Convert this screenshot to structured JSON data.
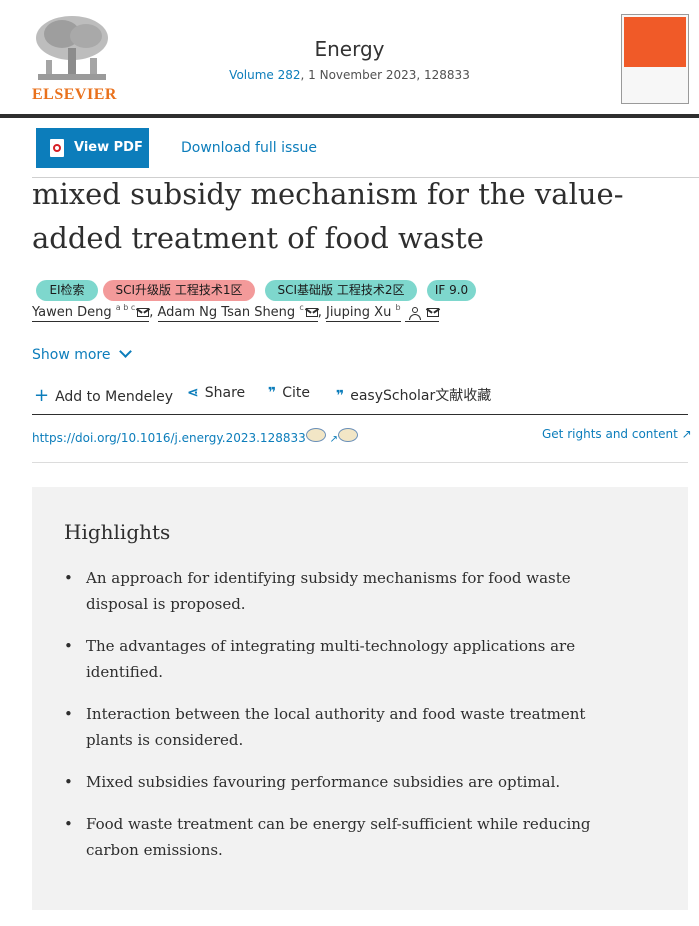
{
  "header": {
    "publisher_logo_text": "ELSEVIER",
    "journal_title": "Energy",
    "volume_link": "Volume 282",
    "issue_info": ", 1 November 2023, 128833"
  },
  "toolbar": {
    "view_pdf_label": "View PDF",
    "download_label": "Download full issue"
  },
  "article": {
    "title": "mixed subsidy mechanism for the value-added treatment of food waste",
    "badges": [
      "EI检索",
      "SCI升级版 工程技术1区",
      "SCI基础版 工程技术2区",
      "IF 9.0"
    ],
    "authors": [
      {
        "name": "Yawen Deng",
        "affil": "a b c"
      },
      {
        "name": "Adam Ng Tsan Sheng",
        "affil": "c"
      },
      {
        "name": "Jiuping Xu",
        "affil": "b"
      }
    ],
    "show_more_label": "Show more"
  },
  "actions": {
    "mendeley": "Add to Mendeley",
    "share": "Share",
    "cite": "Cite",
    "easyscholar": "easyScholar文献收藏"
  },
  "links": {
    "doi": "https://doi.org/10.1016/j.energy.2023.128833",
    "rights": "Get rights and content ↗"
  },
  "highlights": {
    "title": "Highlights",
    "items": [
      "An approach for identifying subsidy mechanisms for food waste disposal is proposed.",
      "The advantages of integrating multi-technology applications are identified.",
      "Interaction between the local authority and food waste treatment plants is considered.",
      "Mixed subsidies favouring performance subsidies are optimal.",
      "Food waste treatment can be energy self-sufficient while reducing carbon emissions."
    ]
  },
  "colors": {
    "link_blue": "#0c7dbb",
    "elsevier_orange": "#e9711c",
    "badge_teal": "#7ed7cd",
    "badge_pink": "#f39a9a"
  }
}
